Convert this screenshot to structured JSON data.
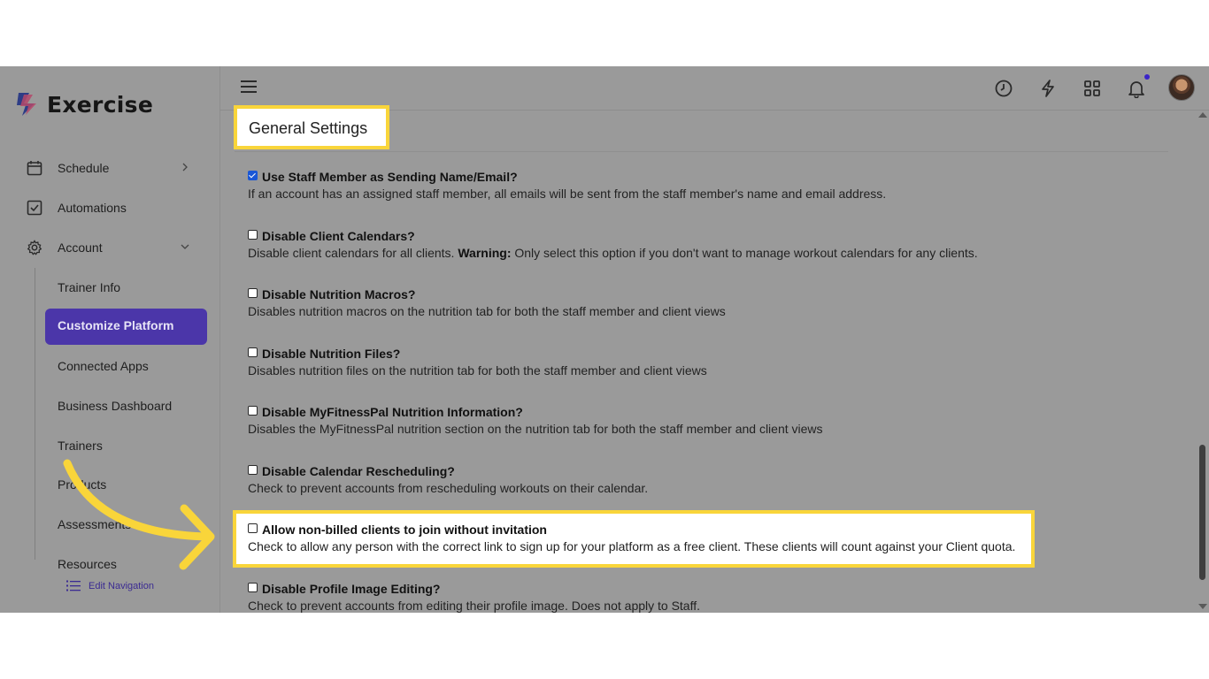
{
  "app": {
    "name": "Exercise"
  },
  "sidebar": {
    "items": [
      {
        "label": "Schedule",
        "icon": "calendar-icon"
      },
      {
        "label": "Automations",
        "icon": "checkbox-icon"
      },
      {
        "label": "Account",
        "icon": "gear-icon"
      }
    ],
    "account_sub_items": [
      "Trainer Info",
      "Customize Platform",
      "Connected Apps",
      "Business Dashboard",
      "Trainers",
      "Products",
      "Assessments",
      "Resources"
    ],
    "active_item": "Customize Platform",
    "edit_navigation": "Edit Navigation"
  },
  "topbar": {
    "icons": [
      "menu-icon",
      "history-icon",
      "lightning-icon",
      "apps-grid-icon",
      "bell-icon",
      "avatar"
    ]
  },
  "main": {
    "title": "General Settings",
    "settings": [
      {
        "label": "Use Staff Member as Sending Name/Email?",
        "checked": true,
        "desc": "If an account has an assigned staff member, all emails will be sent from the staff member's name and email address."
      },
      {
        "label": "Disable Client Calendars?",
        "checked": false,
        "desc_prefix": "Disable client calendars for all clients. ",
        "desc_bold": "Warning:",
        "desc_suffix": " Only select this option if you don't want to manage workout calendars for any clients."
      },
      {
        "label": "Disable Nutrition Macros?",
        "checked": false,
        "desc": "Disables nutrition macros on the nutrition tab for both the staff member and client views"
      },
      {
        "label": "Disable Nutrition Files?",
        "checked": false,
        "desc": "Disables nutrition files on the nutrition tab for both the staff member and client views"
      },
      {
        "label": "Disable MyFitnessPal Nutrition Information?",
        "checked": false,
        "desc": "Disables the MyFitnessPal nutrition section on the nutrition tab for both the staff member and client views"
      },
      {
        "label": "Disable Calendar Rescheduling?",
        "checked": false,
        "desc": "Check to prevent accounts from rescheduling workouts on their calendar."
      },
      {
        "label": "Allow non-billed clients to join without invitation",
        "checked": false,
        "desc": "Check to allow any person with the correct link to sign up for your platform as a free client. These clients will count against your Client quota."
      },
      {
        "label": "Disable Profile Image Editing?",
        "checked": false,
        "desc": "Check to prevent accounts from editing their profile image. Does not apply to Staff."
      }
    ]
  },
  "colors": {
    "accent": "#4b36a9",
    "highlight": "#f9d53a",
    "overlay": "#9a9a9a"
  }
}
